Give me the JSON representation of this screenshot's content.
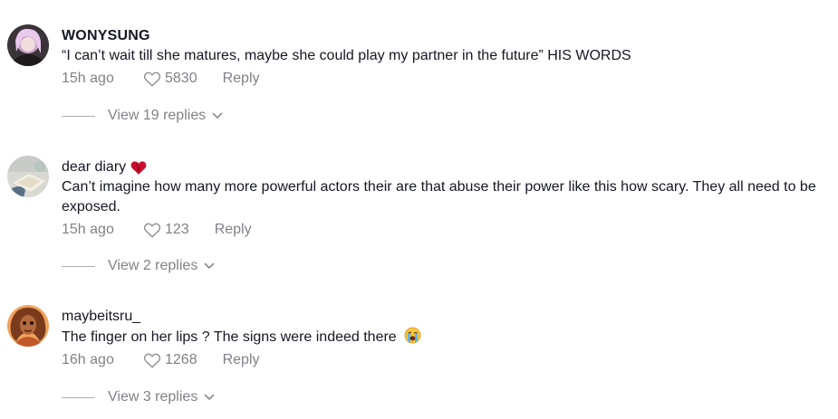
{
  "comments": [
    {
      "username": "WONYSUNG",
      "text": "“I can’t wait till she matures, maybe she could play my partner in the future” HIS WORDS",
      "time": "15h ago",
      "likes": "5830",
      "reply_label": "Reply",
      "view_replies": "View 19 replies"
    },
    {
      "username": "dear diary",
      "username_badge": "heart-emoji",
      "text": "Can’t imagine how many more powerful actors their are that abuse their power like this how scary. They all need to be exposed.",
      "time": "15h ago",
      "likes": "123",
      "reply_label": "Reply",
      "view_replies": "View 2 replies"
    },
    {
      "username": "maybeitsru_",
      "text": "The finger on her lips ? The signs were indeed there",
      "text_emoji": "crying-face-emoji",
      "time": "16h ago",
      "likes": "1268",
      "reply_label": "Reply",
      "view_replies": "View 3 replies"
    }
  ],
  "colors": {
    "text_primary": "#161823",
    "text_secondary": "#8a8b91",
    "heart_badge": "#c8102e"
  }
}
